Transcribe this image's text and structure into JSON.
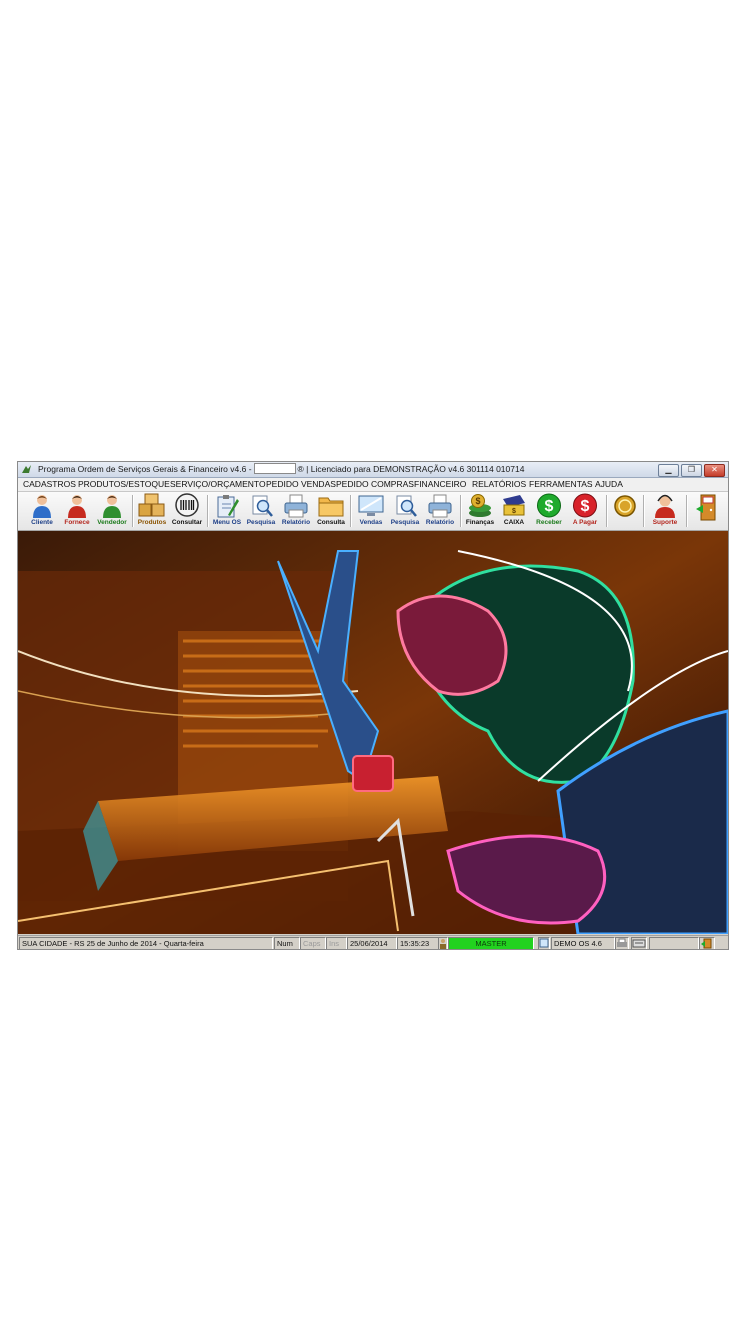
{
  "window": {
    "title_left": "Programa Ordem de Serviços Gerais & Financeiro v4.6 -",
    "title_right": "® | Licenciado para  DEMONSTRAÇÃO v4.6 301114 010714"
  },
  "menu": [
    "CADASTROS",
    "PRODUTOS/ESTOQUE",
    "SERVIÇO/ORÇAMENTO",
    "PEDIDO VENDAS",
    "PEDIDO COMPRAS",
    "FINANCEIRO",
    "RELATÓRIOS",
    "FERRAMENTAS",
    "AJUDA"
  ],
  "toolbar": {
    "cliente": "Cliente",
    "fornece": "Fornece",
    "vendedor": "Vendedor",
    "produtos": "Produtos",
    "consultar": "Consultar",
    "menu_os": "Menu OS",
    "pesquisa": "Pesquisa",
    "relatorio": "Relatório",
    "consulta": "Consulta",
    "vendas": "Vendas",
    "pesquisa2": "Pesquisa",
    "relatorio2": "Relatório",
    "financas": "Finanças",
    "caixa": "CAIXA",
    "receber": "Receber",
    "apagar": "A Pagar",
    "suporte": "Suporte"
  },
  "status": {
    "city": "SUA CIDADE - RS 25 de Junho de 2014 - Quarta-feira",
    "num": "Num",
    "caps": "Caps",
    "ins": "Ins",
    "date": "25/06/2014",
    "time": "15:35:23",
    "user": "MASTER",
    "version": "DEMO OS 4.6"
  },
  "colors": {
    "master_bar": "#22d21f",
    "title_bar": "#dce5f1"
  }
}
